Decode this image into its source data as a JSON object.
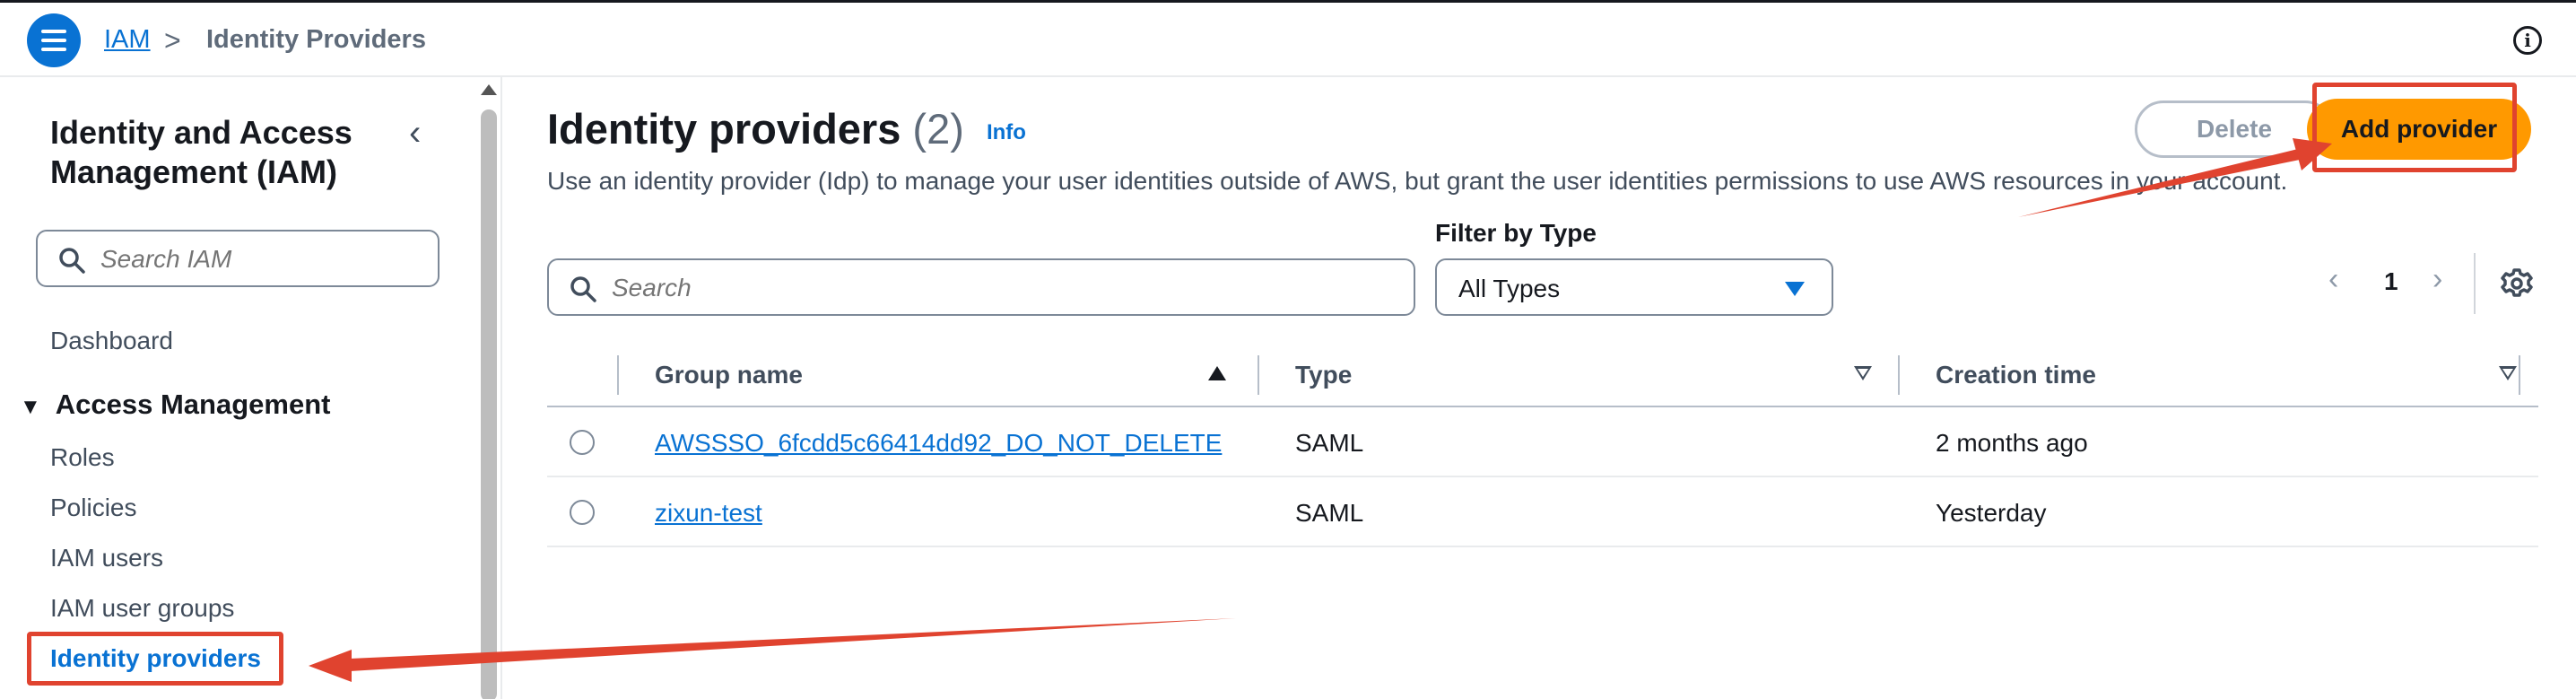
{
  "header": {
    "breadcrumb_root": "IAM",
    "breadcrumb_separator": ">",
    "breadcrumb_current": "Identity Providers",
    "info_icon_glyph": "i"
  },
  "sidebar": {
    "title": "Identity and Access Management (IAM)",
    "close_glyph": "‹",
    "search_placeholder": "Search IAM",
    "dashboard": "Dashboard",
    "section": "Access Management",
    "items": [
      {
        "label": "Roles"
      },
      {
        "label": "Policies"
      },
      {
        "label": "IAM users"
      },
      {
        "label": "IAM user groups"
      },
      {
        "label": "Identity providers",
        "active": true
      }
    ]
  },
  "main": {
    "title": "Identity providers",
    "count": "(2)",
    "info_link": "Info",
    "description": "Use an identity provider (Idp) to manage your user identities outside of AWS, but grant the user identities permissions to use AWS resources in your account.",
    "delete_label": "Delete",
    "add_label": "Add provider",
    "filter_label": "Filter by Type",
    "search_placeholder": "Search",
    "type_selected": "All Types",
    "pager": {
      "prev": "‹",
      "page": "1",
      "next": "›"
    },
    "columns": [
      "Group name",
      "Type",
      "Creation time"
    ],
    "rows": [
      {
        "name": "AWSSSO_6fcdd5c66414dd92_DO_NOT_DELETE",
        "type": "SAML",
        "created": "2 months ago"
      },
      {
        "name": "zixun-test",
        "type": "SAML",
        "created": "Yesterday"
      }
    ]
  },
  "colors": {
    "accent": "#0972d3",
    "primary_button": "#ff9900",
    "annotation": "#e0432f"
  },
  "icons": [
    "menu-icon",
    "info-icon",
    "chevron-left-icon",
    "search-icon",
    "caret-down-icon",
    "settings-icon",
    "sort-ascending-icon",
    "sort-descending-icon"
  ]
}
